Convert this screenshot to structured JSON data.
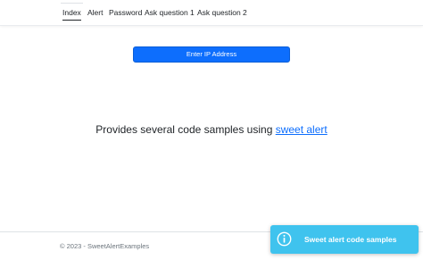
{
  "nav": {
    "items": [
      {
        "label": "Index",
        "active": true
      },
      {
        "label": "Alert"
      },
      {
        "label": "Password"
      },
      {
        "label": "Ask question 1"
      },
      {
        "label": "Ask question 2"
      }
    ]
  },
  "main": {
    "button_label": "Enter IP Address",
    "lead_text": "Provides several code samples using ",
    "lead_link": "sweet alert"
  },
  "footer": {
    "text": "© 2023 - SweetAlertExamples"
  },
  "toast": {
    "icon": "info-icon",
    "title": "Sweet alert code samples",
    "color": "#3fc3ee"
  },
  "colors": {
    "primary": "#0d6efd",
    "link": "#0d6efd",
    "toast": "#3fc3ee"
  }
}
